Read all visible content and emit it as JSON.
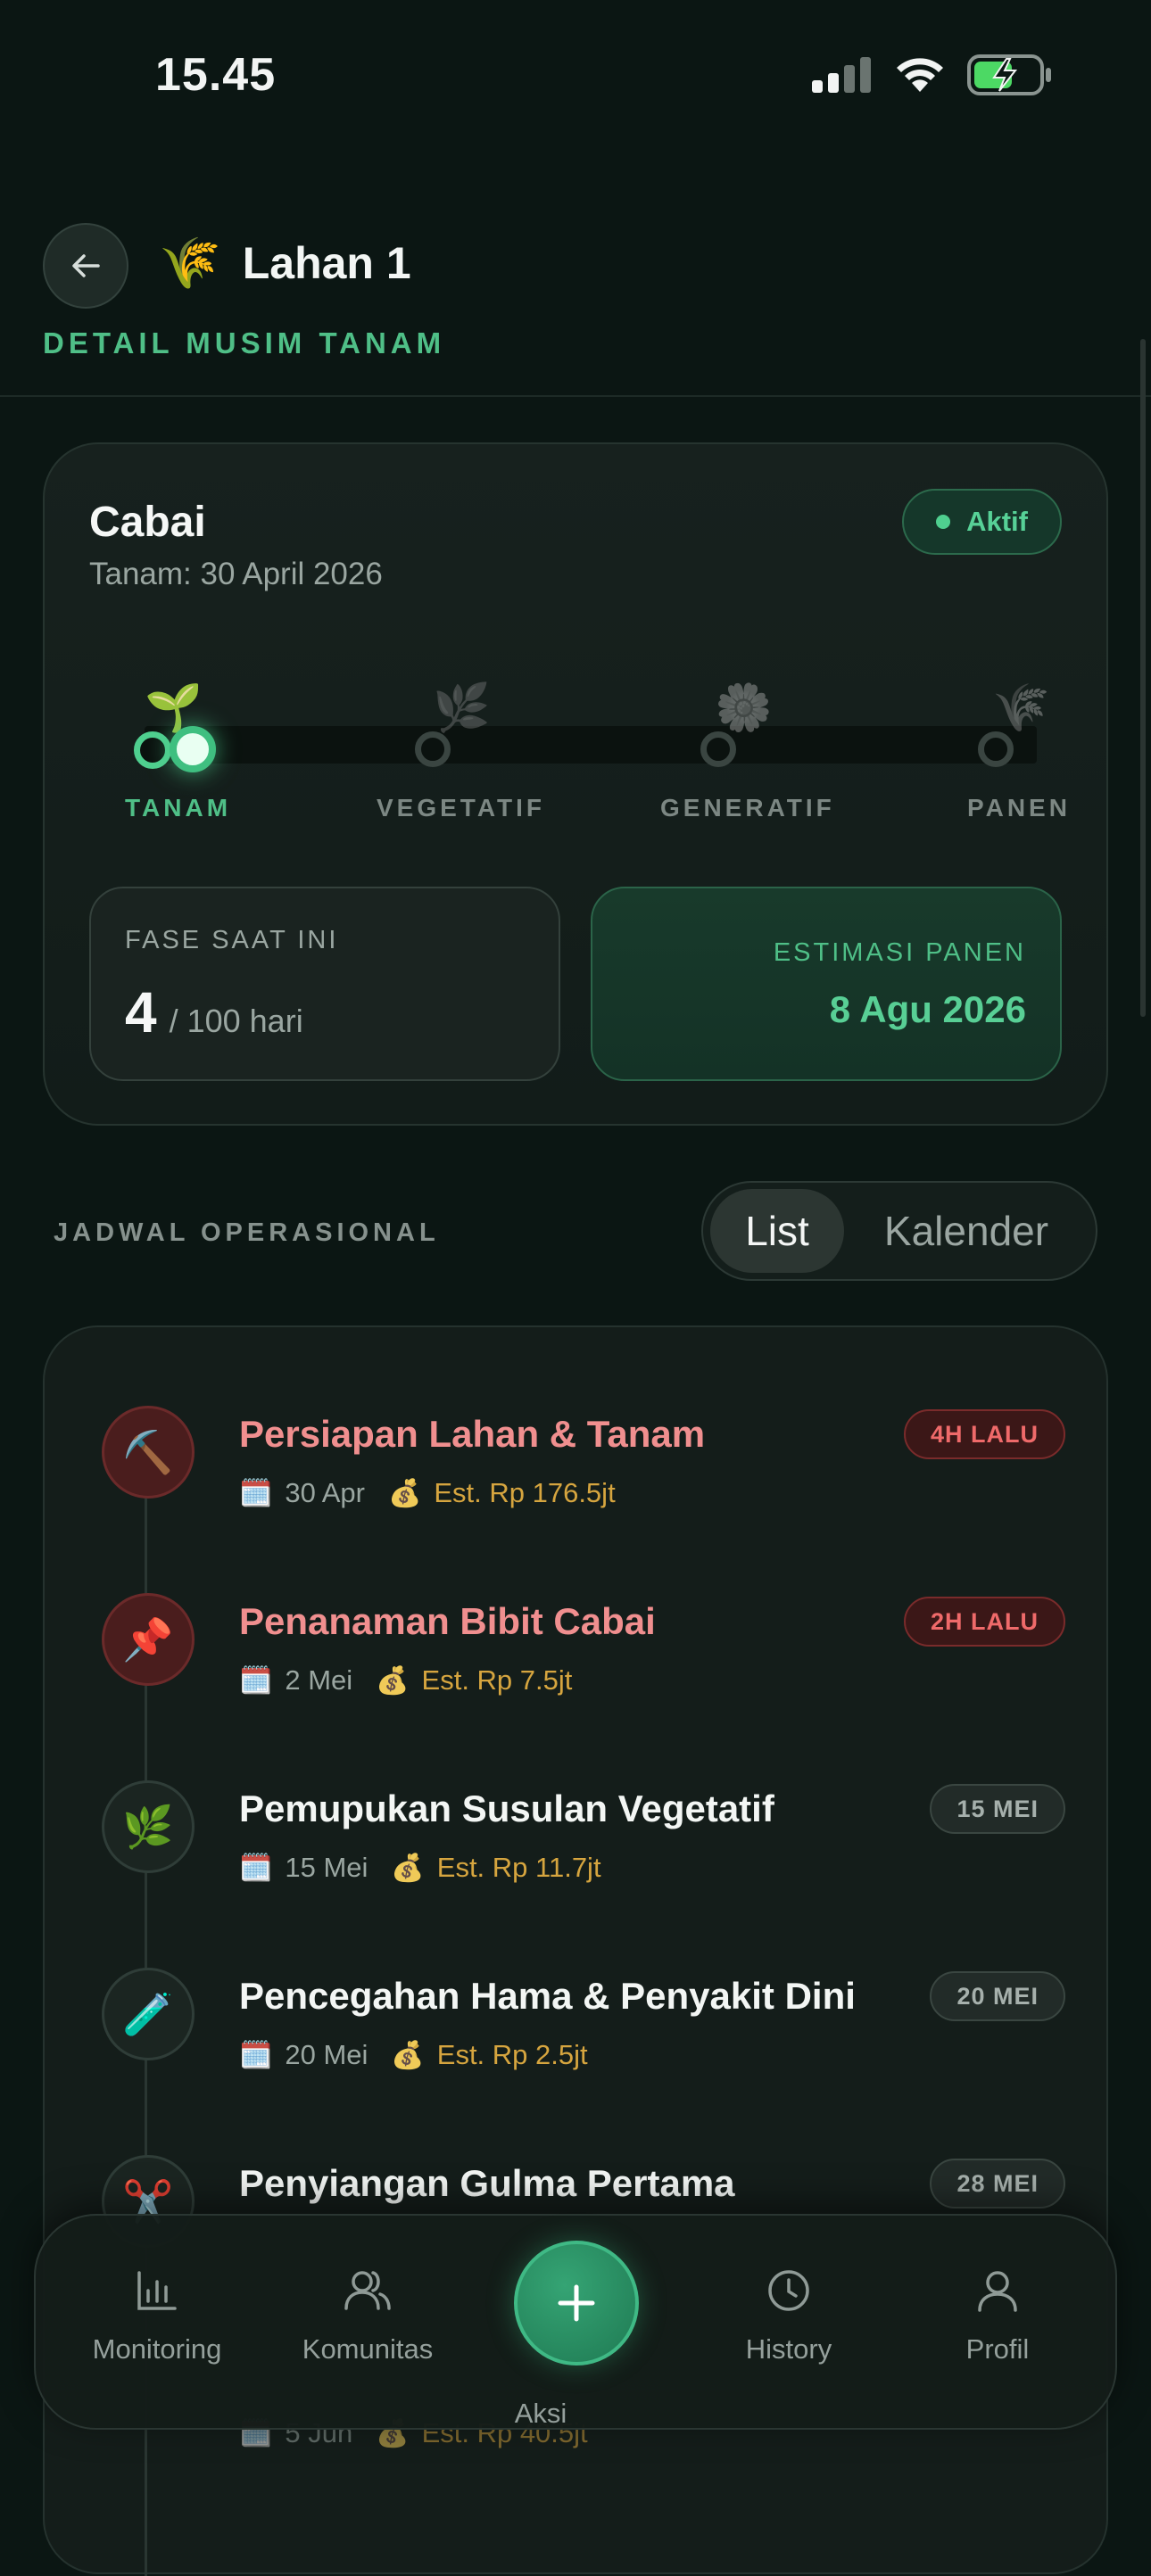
{
  "status_bar": {
    "time": "15.45"
  },
  "header": {
    "emoji": "🌾",
    "title": "Lahan 1",
    "subtitle": "DETAIL MUSIM TANAM"
  },
  "season": {
    "crop": "Cabai",
    "plant_date": "Tanam: 30 April 2026",
    "status": "Aktif",
    "phases": [
      {
        "label": "TANAM",
        "icon": "🌱",
        "active": true
      },
      {
        "label": "VEGETATIF",
        "icon": "🌿",
        "active": false
      },
      {
        "label": "GENERATIF",
        "icon": "🌼",
        "active": false
      },
      {
        "label": "PANEN",
        "icon": "🌾",
        "active": false
      }
    ],
    "current_phase": {
      "label": "FASE SAAT INI",
      "day": "4",
      "total": "/ 100 hari"
    },
    "harvest": {
      "label": "ESTIMASI PANEN",
      "date": "8 Agu 2026"
    }
  },
  "schedule": {
    "title": "JADWAL OPERASIONAL",
    "toggle": {
      "list": "List",
      "calendar": "Kalender",
      "selected": "List"
    },
    "tasks": [
      {
        "icon": "⛏️",
        "title": "Persiapan Lahan & Tanam",
        "date": "30 Apr",
        "cost": "Est. Rp 176.5jt",
        "tag": "4H LALU",
        "state": "overdue"
      },
      {
        "icon": "📌",
        "title": "Penanaman Bibit Cabai",
        "date": "2 Mei",
        "cost": "Est. Rp 7.5jt",
        "tag": "2H LALU",
        "state": "overdue"
      },
      {
        "icon": "🌿",
        "title": "Pemupukan Susulan Vegetatif",
        "date": "15 Mei",
        "cost": "Est. Rp 11.7jt",
        "tag": "15 MEI",
        "state": "future"
      },
      {
        "icon": "🧪",
        "title": "Pencegahan Hama & Penyakit Dini",
        "date": "20 Mei",
        "cost": "Est. Rp 2.5jt",
        "tag": "20 MEI",
        "state": "future"
      },
      {
        "icon": "✂️",
        "title": "Penyiangan Gulma Pertama",
        "date": "",
        "cost": "",
        "tag": "28 MEI",
        "state": "future"
      }
    ],
    "partial_row": {
      "date": "5 Jun",
      "cost": "Est. Rp 40.5jt"
    }
  },
  "bottom_nav": {
    "items": [
      {
        "label": "Monitoring",
        "icon": "bar-chart-icon"
      },
      {
        "label": "Komunitas",
        "icon": "users-icon"
      },
      {
        "label": "Aksi",
        "icon": "plus-icon"
      },
      {
        "label": "History",
        "icon": "clock-icon"
      },
      {
        "label": "Profil",
        "icon": "user-icon"
      }
    ]
  },
  "colors": {
    "accent": "#4fbf87",
    "overdue": "#ef6a6a",
    "cost": "#d6a53f",
    "background": "#0b1613"
  }
}
